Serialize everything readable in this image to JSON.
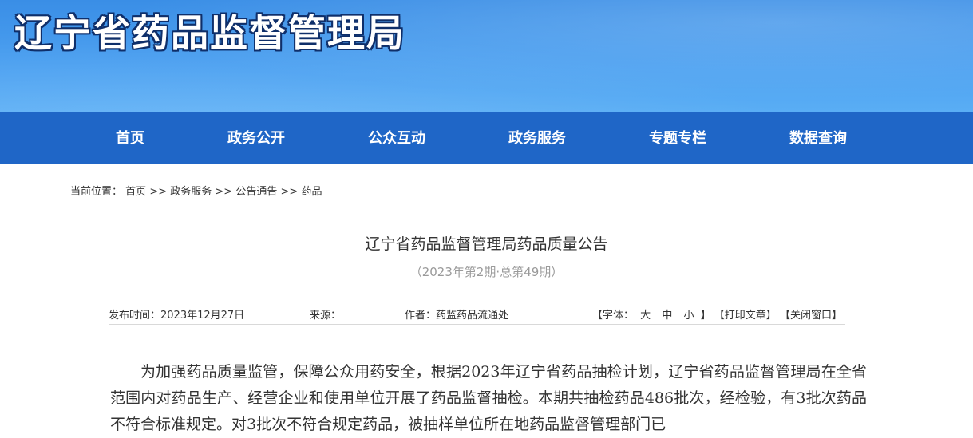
{
  "header": {
    "site_title": "辽宁省药品监督管理局"
  },
  "nav": {
    "items": [
      "首页",
      "政务公开",
      "公众互动",
      "政务服务",
      "专题专栏",
      "数据查询"
    ]
  },
  "breadcrumb": {
    "prefix": "当前位置：",
    "items": [
      "首页",
      "政务服务",
      "公告通告",
      "药品"
    ],
    "separator": ">>"
  },
  "article": {
    "title": "辽宁省药品监督管理局药品质量公告",
    "subtitle": "（2023年第2期·总第49期）",
    "meta": {
      "publish_time": "发布时间：2023年12月27日",
      "source": "来源：",
      "author": "作者：药监药品流通处",
      "font_label": "【字体：",
      "font_large": "大",
      "font_medium": "中",
      "font_small": "小",
      "font_close": "】",
      "print": "【打印文章】",
      "close_window": "【关闭窗口】"
    },
    "body": "为加强药品质量监管，保障公众用药安全，根据2023年辽宁省药品抽检计划，辽宁省药品监督管理局在全省范围内对药品生产、经营企业和使用单位开展了药品监督抽检。本期共抽检药品486批次，经检验，有3批次药品不符合标准规定。对3批次不符合规定药品，被抽样单位所在地药品监督管理部门已"
  },
  "colors": {
    "nav_bg": "#1f66c7",
    "header_bg": "#4a9ff0",
    "title_outline": "#0f2f6a"
  }
}
